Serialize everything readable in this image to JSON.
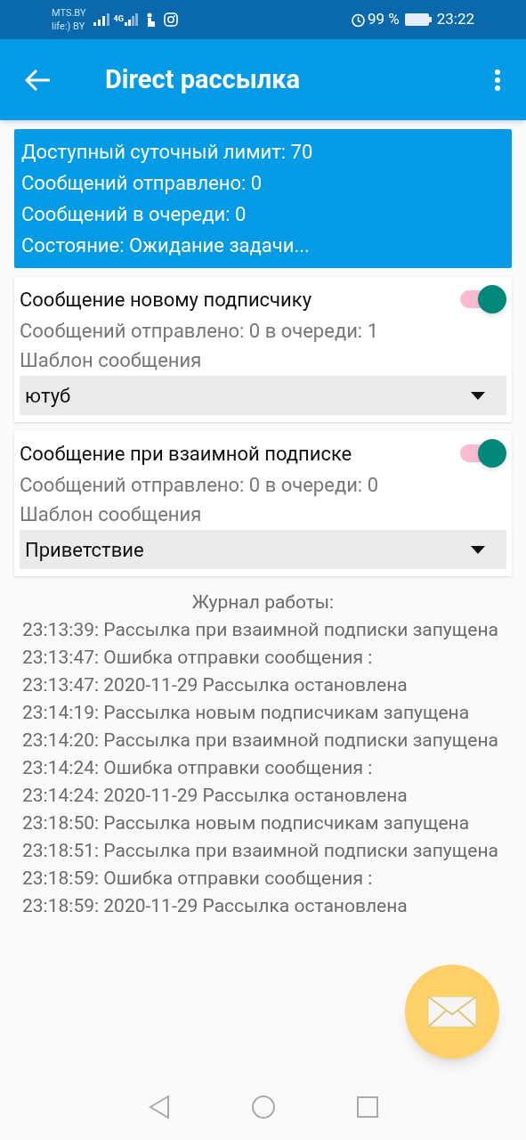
{
  "status_bar": {
    "carriers": [
      "MTS.BY",
      "life:) BY"
    ],
    "network": "4G",
    "battery_percent": "99 %",
    "time": "23:22"
  },
  "app_bar": {
    "title": "Direct рассылка"
  },
  "summary": [
    "Доступный суточный лимит: 70",
    "Сообщений отправлено: 0",
    "Сообщений в очереди: 0",
    "Состояние: Ожидание задачи..."
  ],
  "sections": [
    {
      "title": "Сообщение новому подписчику",
      "on": true,
      "stats": "Сообщений отправлено: 0 в очереди: 1",
      "template_label": "Шаблон сообщения",
      "template_value": "ютуб"
    },
    {
      "title": "Сообщение при взаимной подписке",
      "on": true,
      "stats": "Сообщений отправлено: 0 в очереди: 0",
      "template_label": "Шаблон сообщения",
      "template_value": "Приветствие"
    }
  ],
  "log": {
    "title": "Журнал работы:",
    "entries": [
      "23:13:39: Рассылка при взаимной подписки запущена",
      "23:13:47: Ошибка отправки сообщения :",
      "23:13:47: 2020-11-29 Рассылка остановлена",
      "23:14:19: Рассылка новым подписчикам запущена",
      "23:14:20: Рассылка при взаимной подписки запущена",
      "23:14:24: Ошибка отправки сообщения :",
      "23:14:24: 2020-11-29 Рассылка остановлена",
      "23:18:50: Рассылка новым подписчикам запущена",
      "23:18:51: Рассылка при взаимной подписки запущена",
      "23:18:59: Ошибка отправки сообщения :",
      "23:18:59: 2020-11-29 Рассылка остановлена"
    ]
  }
}
